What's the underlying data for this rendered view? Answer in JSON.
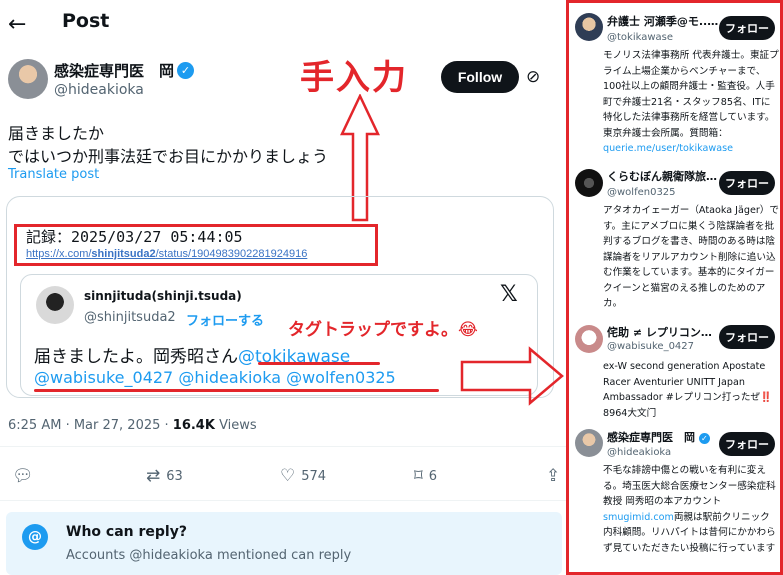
{
  "post": {
    "title": "Post",
    "author": {
      "name": "感染症専門医　岡",
      "handle": "@hideakioka"
    },
    "follow_label": "Follow",
    "lines": [
      "届きましたか",
      "ではいつか刑事法廷でお目にかかりましょう"
    ],
    "translate": "Translate post",
    "record_label": "記録：2025/03/27 05:44:05",
    "record_url_pre": "https://x.com/",
    "record_url_bold": "shinjitsuda2",
    "record_url_post": "/status/1904983902281924916",
    "quoted": {
      "name": "sinnjituda(shinji.tsuda)",
      "handle": "@shinjitsuda2",
      "follow": "フォローする",
      "text1_plain": "届きましたよ。岡秀昭さん",
      "text1_mention": "@tokikawase",
      "text2": "@wabisuke_0427 @hideakioka @wolfen0325"
    },
    "meta_time": "6:25 AM · Mar 27, 2025 · ",
    "meta_views": "16.4K",
    "meta_views_label": " Views",
    "actions": {
      "retweets": "63",
      "likes": "574",
      "bookmarks": "6"
    },
    "reply": {
      "title": "Who can reply?",
      "sub": "Accounts @hideakioka mentioned can reply"
    }
  },
  "annotations": {
    "manual": "手入力",
    "tagtrap": "タグトラップですよ。😂"
  },
  "panel": {
    "follow_label": "フォロー",
    "accounts": [
      {
        "name": "弁護士 河瀬季@モ...",
        "verified": true,
        "handle": "@tokikawase",
        "bio": "モノリス法律事務所 代表弁護士。東証プライム上場企業からベンチャーまで、100社以上の顧問弁護士・監査役。人手町で弁護士21名・スタッフ85名、ITに特化した法律事務所を経営しています。東京弁護士会所属。質問箱：",
        "bio_link": "querie.me/user/tokikawase"
      },
      {
        "name": "くらむぼん親衛隊旅団...",
        "verified": false,
        "handle": "@wolfen0325",
        "bio": "アタオカイェーガー（Ataoka Jäger）です。主にアメブロに巣くう陰謀論者を批判するブログを書き、時間のある時は陰謀論者をリアルアカウント削除に追い込む作業をしています。基本的にタイガークイーンと猫宮のえる推しのためのアカ。",
        "bio_link": ""
      },
      {
        "name": "侘助 ≠ レプリコン接...",
        "verified": false,
        "handle": "@wabisuke_0427",
        "bio": "ex-W second generation Apostate Racer Aventurier UNITT Japan Ambassador #レプリコン打ったぜ‼️ 8964大文门",
        "bio_link": ""
      },
      {
        "name": "感染症専門医　岡",
        "verified": true,
        "handle": "@hideakioka",
        "bio": "不毛な誹謗中傷との戦いを有利に変える。埼玉医大総合医療センター感染症科教授 岡秀昭の本アカウント",
        "bio_link": "smugimid.com",
        "bio_after": "両親は駅前クリニック内科顧問。リハパイトは昔何にかかわらず見ていただきたい投稿に行っています"
      }
    ]
  },
  "colors": {
    "accent": "#1d9bf0",
    "annotation": "#e3262b",
    "dark": "#0f1419"
  }
}
